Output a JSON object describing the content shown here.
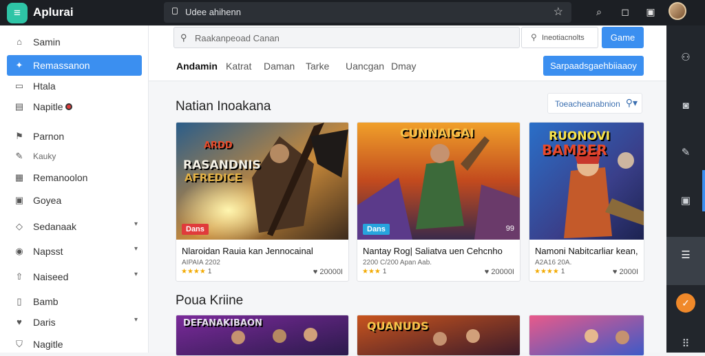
{
  "topbar": {
    "app_title": "Aplurai",
    "address": "Udee ahihenn"
  },
  "sidebar": {
    "items": [
      {
        "label": "Samin",
        "icon": "home-icon"
      },
      {
        "label": "Remassanon",
        "icon": "star-icon",
        "active": true
      },
      {
        "label": "Htala",
        "icon": "tag-icon"
      },
      {
        "label": "Napitle",
        "icon": "note-icon",
        "dot": true
      },
      {
        "label": "Parnon",
        "icon": "bookmark-icon"
      },
      {
        "label": "Kauky",
        "icon": "pin-icon"
      },
      {
        "label": "Remanoolon",
        "icon": "edit-icon"
      },
      {
        "label": "Goyea",
        "icon": "square-icon"
      },
      {
        "label": "Sedanaak",
        "icon": "diamond-icon",
        "chevron": true
      },
      {
        "label": "Napsst",
        "icon": "circle-icon",
        "chevron": true
      },
      {
        "label": "Naiseed",
        "icon": "upload-icon",
        "chevron": true
      },
      {
        "label": "Bamb",
        "icon": "trash-icon"
      },
      {
        "label": "Daris",
        "icon": "heart-icon",
        "chevron": true
      },
      {
        "label": "Nagitle",
        "icon": "shield-icon"
      }
    ]
  },
  "header": {
    "search_placeholder": "Raakanpeoad Canan",
    "search2_placeholder": "Ineotiacnolts",
    "search_button": "Game",
    "tabs": [
      "Andamin",
      "Katrat",
      "Daman",
      "Tarke",
      "Uancgan",
      "Dmay"
    ],
    "action_button": "Sarpaadsgaehbiiaaoy"
  },
  "section1": {
    "title": "Natian Inoakana",
    "sort_label": "Toeacheanabnion"
  },
  "section2": {
    "title": "Poua Kriine"
  },
  "cards": [
    {
      "art_title_1": "ARDD",
      "art_title_2": "RASANDNIS",
      "art_title_3": "AFREDICE",
      "badge": "Dans",
      "title": "Nlaroidan Rauia kan Jennocainal",
      "sub": "AIPAIA 2202",
      "stars": "★★★★",
      "rating": "1",
      "downloads": "20000I"
    },
    {
      "art_title_1": "CUNNAIGAI",
      "art_title_2": "",
      "art_title_3": "",
      "badge": "Dans",
      "badge2": "99",
      "title": "Nantay Rog| Saliatva uen Cehcnho",
      "sub": "2200 C/200  Apan Aab.",
      "stars": "★★★",
      "rating": "1",
      "downloads": "20000I"
    },
    {
      "art_title_1": "RUONOVI",
      "art_title_2": "BAMBER",
      "art_title_3": "",
      "badge": "",
      "title": "Namoni Nabitcarliar kean,",
      "sub": "A2A16 20A.",
      "stars": "★★★★",
      "rating": "1",
      "downloads": "2000I"
    }
  ],
  "cards2": [
    {
      "art_title": "DEFANAKIBAON"
    },
    {
      "art_title": "QUANUDS"
    },
    {
      "art_title": ""
    }
  ],
  "colors": {
    "accent": "#3b8ff0",
    "topbar": "#1c1f24",
    "rail": "#22262c",
    "orange": "#f0892a"
  }
}
